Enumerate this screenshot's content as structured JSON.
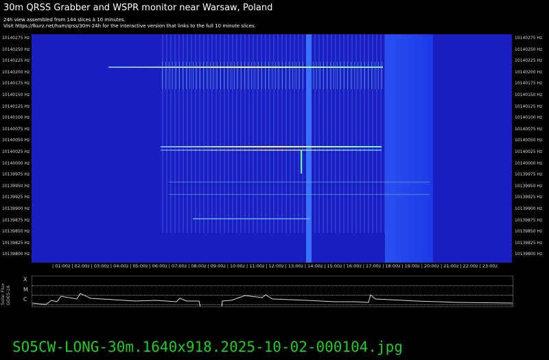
{
  "header": {
    "title": "30m QRSS Grabber and WSPR monitor near Warsaw, Poland",
    "subtitle1": "24h view assembled from 144 slices à 10 minutes.",
    "subtitle2": "Visit https://fkurz.net/ham/qrss/30m-24h for the interactive version that links to the full 10 minute slices."
  },
  "frequency_labels": [
    "10140275 Hz",
    "10140250 Hz",
    "10140225 Hz",
    "10140200 Hz",
    "10140175 Hz",
    "10140150 Hz",
    "10140125 Hz",
    "10140100 Hz",
    "10140075 Hz",
    "10140050 Hz",
    "10140025 Hz",
    "10140000 Hz",
    "10139975 Hz",
    "10139950 Hz",
    "10139925 Hz",
    "10139900 Hz",
    "10139875 Hz",
    "10139850 Hz",
    "10139825 Hz",
    "10139800 Hz"
  ],
  "time_labels": [
    "01:00z",
    "02:00z",
    "03:00z",
    "04:00z",
    "05:00z",
    "06:00z",
    "07:00z",
    "08:00z",
    "09:00z",
    "10:00z",
    "11:00z",
    "12:00z",
    "13:00z",
    "14:00z",
    "15:00z",
    "16:00z",
    "17:00z",
    "18:00z",
    "19:00z",
    "20:00z",
    "21:00z",
    "22:00z",
    "23:00z"
  ],
  "solar_flux": {
    "label": "Solar Flux GOES-16",
    "levels": [
      "X",
      "M",
      "C"
    ]
  },
  "filename": "SO5CW-LONG-30m.1640x918.2025-10-02-000104.jpg",
  "colors": {
    "waterfall": "#1a1ec0",
    "filename": "#22cc22"
  }
}
